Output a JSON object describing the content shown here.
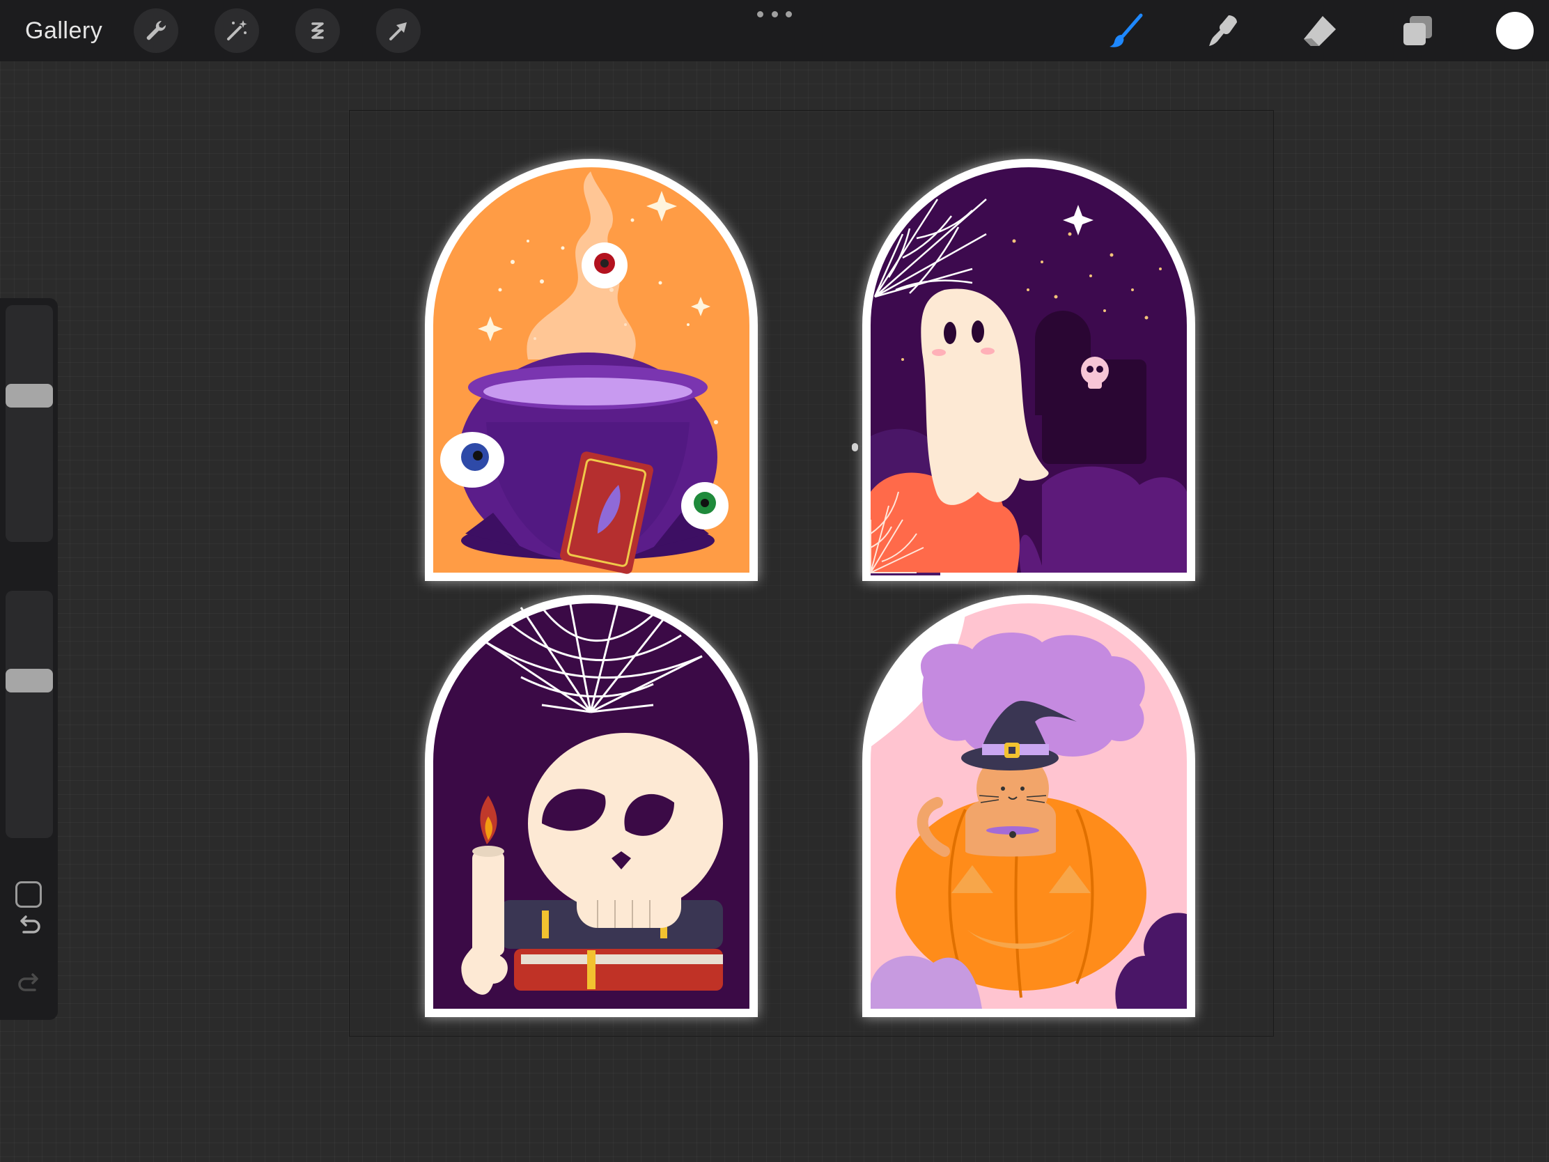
{
  "topbar": {
    "gallery_label": "Gallery",
    "left_tools": [
      {
        "icon": "wrench-icon",
        "name": "actions"
      },
      {
        "icon": "magic-wand-icon",
        "name": "adjustments"
      },
      {
        "icon": "selection-icon",
        "name": "selection"
      },
      {
        "icon": "transform-arrow-icon",
        "name": "transform"
      }
    ],
    "right_tools": [
      {
        "icon": "brush-icon",
        "name": "paint",
        "active": true
      },
      {
        "icon": "smudge-icon",
        "name": "smudge"
      },
      {
        "icon": "eraser-icon",
        "name": "erase"
      },
      {
        "icon": "layers-icon",
        "name": "layers"
      }
    ],
    "active_color": "#ffffff",
    "accent": "#1e88ff"
  },
  "sidebar": {
    "brush_size_level": 0.63,
    "opacity_level": 0.65
  },
  "canvas": {
    "stickers": [
      "cauldron",
      "ghost",
      "skull",
      "cat-pumpkin"
    ]
  }
}
